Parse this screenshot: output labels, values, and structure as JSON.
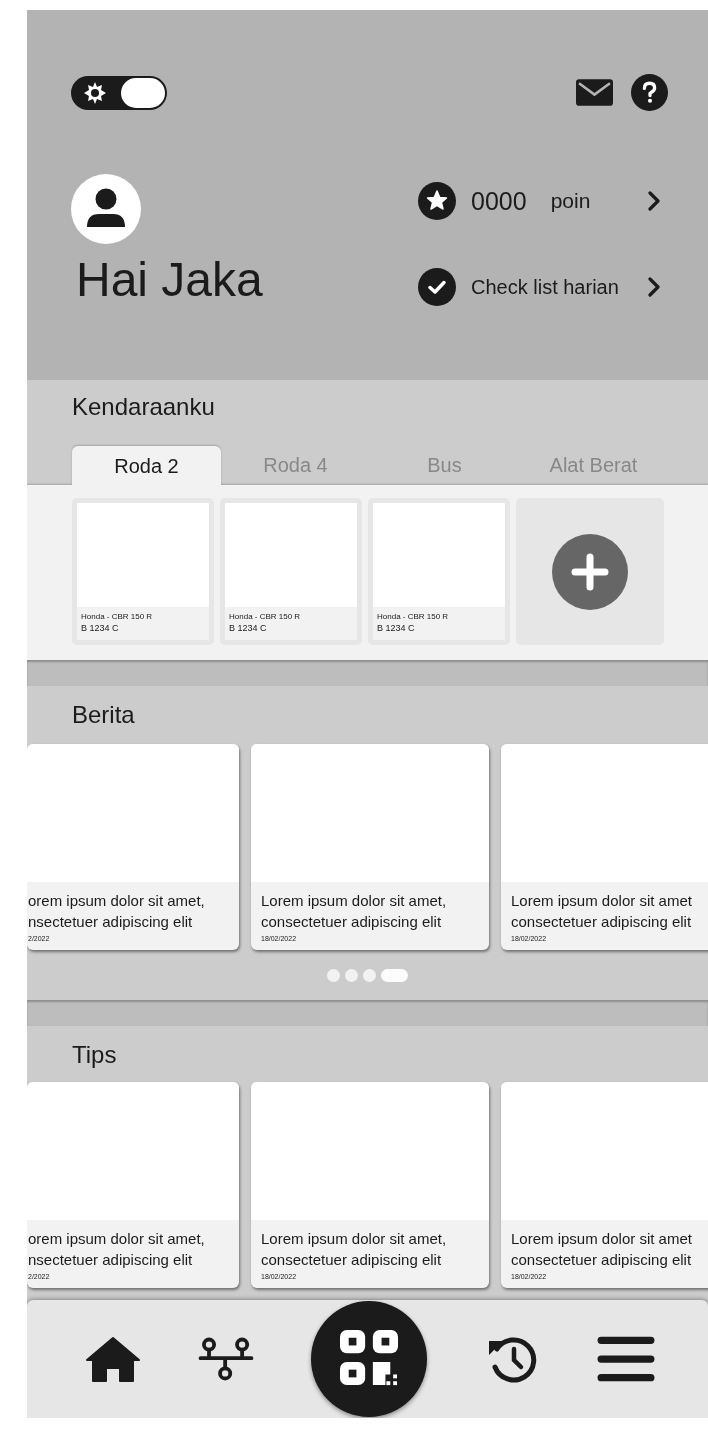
{
  "header": {
    "theme_toggle": {
      "on": true
    },
    "greeting": "Hai Jaka",
    "points": {
      "value": "0000",
      "unit": "poin"
    },
    "checklist": {
      "label": "Check list harian"
    }
  },
  "vehicles": {
    "title": "Kendaraanku",
    "tabs": [
      {
        "label": "Roda 2",
        "selected": true
      },
      {
        "label": "Roda 4",
        "selected": false
      },
      {
        "label": "Bus",
        "selected": false
      },
      {
        "label": "Alat Berat",
        "selected": false
      }
    ],
    "items": [
      {
        "model": "Honda - CBR 150 R",
        "plate": "B 1234 C"
      },
      {
        "model": "Honda - CBR 150 R",
        "plate": "B 1234 C"
      },
      {
        "model": "Honda - CBR 150 R",
        "plate": "B 1234 C"
      }
    ]
  },
  "news": {
    "title": "Berita",
    "cards": [
      {
        "line1": "orem ipsum dolor sit amet,",
        "line2": "nsectetuer adipiscing elit",
        "date": "2/2022"
      },
      {
        "line1": "Lorem ipsum dolor sit amet,",
        "line2": "consectetuer adipiscing elit",
        "date": "18/02/2022"
      },
      {
        "line1": "Lorem ipsum dolor sit amet",
        "line2": "consectetuer adipiscing elit",
        "date": "18/02/2022"
      }
    ],
    "dots": [
      {
        "selected": false
      },
      {
        "selected": false
      },
      {
        "selected": false
      },
      {
        "selected": true
      }
    ]
  },
  "tips": {
    "title": "Tips",
    "cards": [
      {
        "line1": "orem ipsum dolor sit amet,",
        "line2": "nsectetuer adipiscing elit",
        "date": "2/2022"
      },
      {
        "line1": "Lorem ipsum dolor sit amet,",
        "line2": "consectetuer adipiscing elit",
        "date": "18/02/2022"
      },
      {
        "line1": "Lorem ipsum dolor sit amet",
        "line2": "consectetuer adipiscing elit",
        "date": "18/02/2022"
      }
    ]
  }
}
